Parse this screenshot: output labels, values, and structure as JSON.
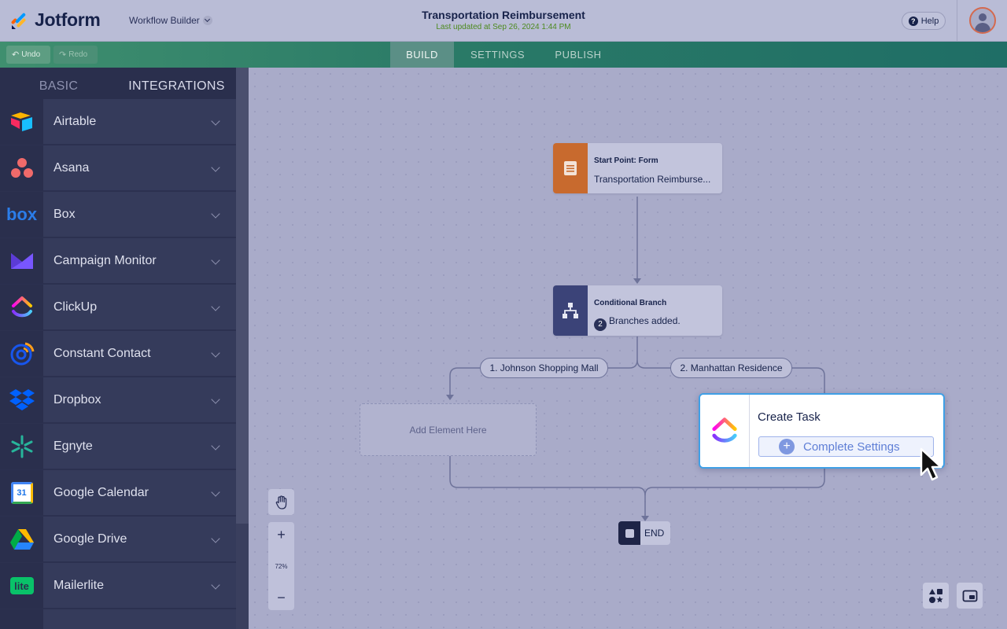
{
  "header": {
    "logo_text": "Jotform",
    "product": "Workflow Builder",
    "doc_title": "Transportation Reimbursement",
    "last_updated": "Last updated at Sep 26, 2024 1:44 PM",
    "help_label": "Help"
  },
  "toolbar": {
    "undo_label": "Undo",
    "redo_label": "Redo",
    "tabs": [
      {
        "label": "BUILD",
        "active": true
      },
      {
        "label": "SETTINGS",
        "active": false
      },
      {
        "label": "PUBLISH",
        "active": false
      }
    ]
  },
  "sidebar": {
    "tabs": [
      {
        "label": "BASIC",
        "active": false
      },
      {
        "label": "INTEGRATIONS",
        "active": true
      }
    ],
    "items": [
      {
        "label": "Airtable",
        "icon": "airtable-icon"
      },
      {
        "label": "Asana",
        "icon": "asana-icon"
      },
      {
        "label": "Box",
        "icon": "box-icon"
      },
      {
        "label": "Campaign Monitor",
        "icon": "campaign-monitor-icon"
      },
      {
        "label": "ClickUp",
        "icon": "clickup-icon"
      },
      {
        "label": "Constant Contact",
        "icon": "constant-contact-icon"
      },
      {
        "label": "Dropbox",
        "icon": "dropbox-icon"
      },
      {
        "label": "Egnyte",
        "icon": "egnyte-icon"
      },
      {
        "label": "Google Calendar",
        "icon": "google-calendar-icon"
      },
      {
        "label": "Google Drive",
        "icon": "google-drive-icon"
      },
      {
        "label": "Mailerlite",
        "icon": "mailerlite-icon"
      }
    ],
    "box_icon_text": "box",
    "calendar_icon_text": "31",
    "mailerlite_icon_text": "lite"
  },
  "canvas": {
    "start_node": {
      "title": "Start Point: Form",
      "subtitle": "Transportation Reimburse..."
    },
    "branch_node": {
      "title": "Conditional Branch",
      "count": "2",
      "text": "Branches added."
    },
    "branches": [
      {
        "label": "1. Johnson Shopping Mall"
      },
      {
        "label": "2. Manhattan Residence"
      }
    ],
    "add_element": "Add Element Here",
    "task": {
      "title": "Create Task",
      "button": "Complete Settings"
    },
    "end_label": "END",
    "zoom": {
      "level": "72%",
      "plus": "+",
      "minus": "−"
    }
  },
  "colors": {
    "accent_green": "#2a7a67",
    "start_orange": "#c86a2e",
    "branch_navy": "#3b4378",
    "task_border": "#3fa0e6"
  }
}
